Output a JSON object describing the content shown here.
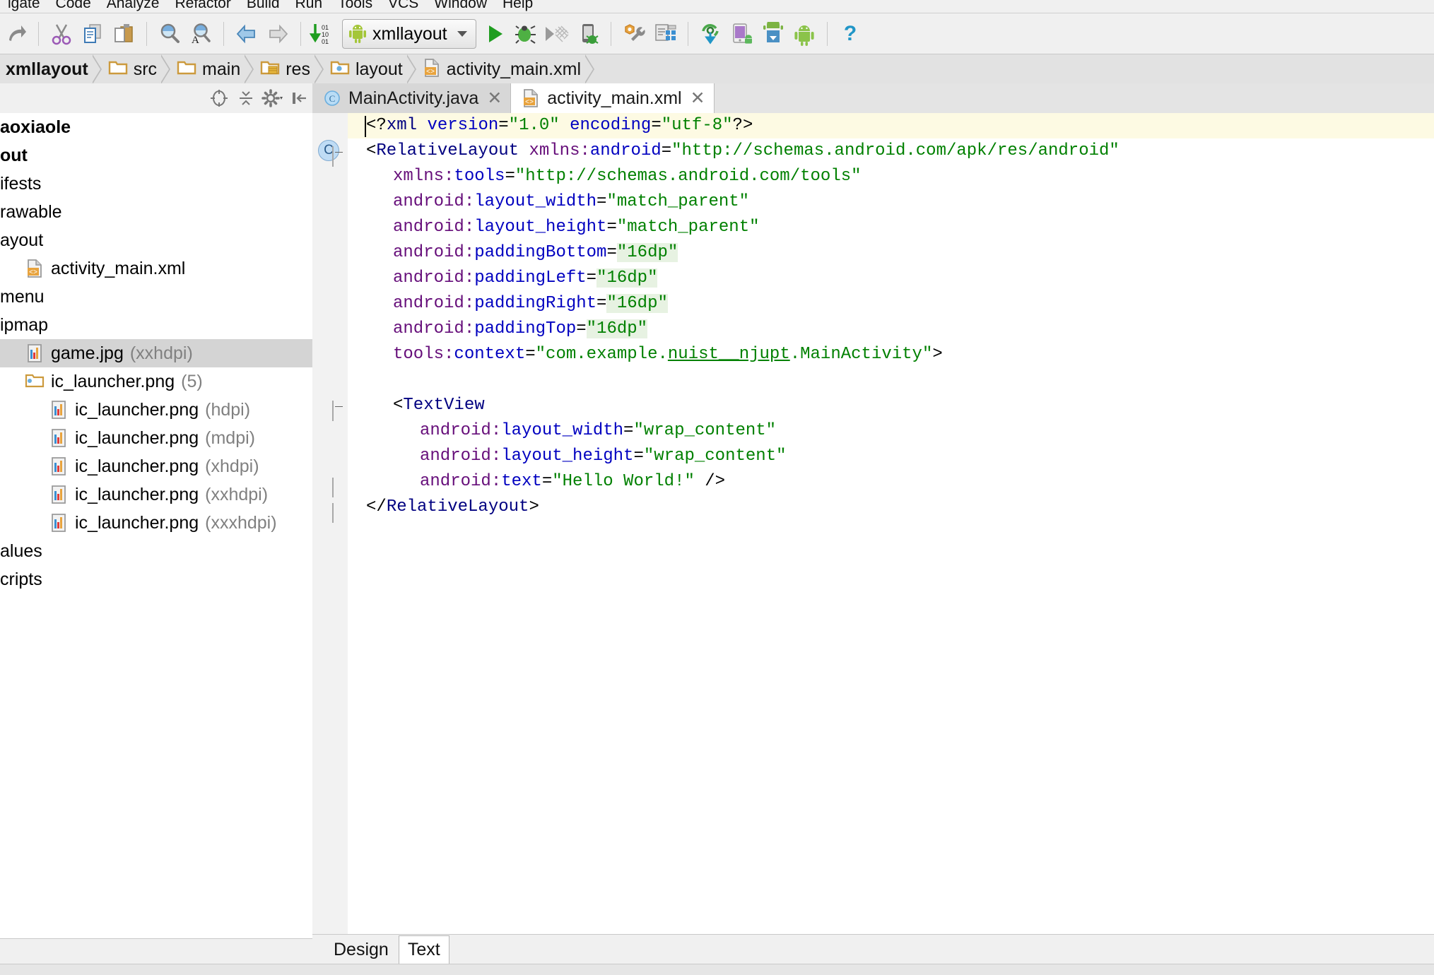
{
  "menu": {
    "items": [
      "igate",
      "Code",
      "Analyze",
      "Refactor",
      "Build",
      "Run",
      "Tools",
      "VCS",
      "Window",
      "Help"
    ]
  },
  "toolbar": {
    "run_config_label": "xmllayout",
    "icons": [
      "redo-icon",
      "cut-icon",
      "copy-icon",
      "paste-icon",
      "find-icon",
      "replace-icon",
      "back-icon",
      "forward-icon",
      "update-project-icon",
      "run-icon",
      "debug-icon",
      "coverage-icon",
      "android-device-debug-icon",
      "sdk-manager-icon",
      "avd-manager-icon",
      "gradle-sync-icon",
      "android-device-monitor-icon",
      "sdk-download-icon",
      "android-icon",
      "help-icon"
    ]
  },
  "breadcrumb": {
    "items": [
      {
        "label": "xmllayout",
        "icon": "module-icon"
      },
      {
        "label": "src",
        "icon": "folder-icon"
      },
      {
        "label": "main",
        "icon": "folder-icon"
      },
      {
        "label": "res",
        "icon": "res-folder-icon"
      },
      {
        "label": "layout",
        "icon": "layout-folder-icon"
      },
      {
        "label": "activity_main.xml",
        "icon": "xml-file-icon"
      }
    ]
  },
  "project_panel": {
    "toolbar_icons": [
      "collapse-caret-icon",
      "locate-target-icon",
      "collapse-all-icon",
      "settings-gear-icon",
      "hide-panel-icon"
    ],
    "tree": [
      {
        "label": "aoxiaole",
        "bold": true,
        "qualifier": "",
        "indent": 0,
        "icon": "",
        "selected": false
      },
      {
        "label": "out",
        "bold": true,
        "qualifier": "",
        "indent": 0,
        "icon": "",
        "selected": false
      },
      {
        "label": "ifests",
        "bold": false,
        "qualifier": "",
        "indent": 0,
        "icon": "",
        "selected": false
      },
      {
        "label": "rawable",
        "bold": false,
        "qualifier": "",
        "indent": 0,
        "icon": "",
        "selected": false
      },
      {
        "label": "ayout",
        "bold": false,
        "qualifier": "",
        "indent": 0,
        "icon": "",
        "selected": false
      },
      {
        "label": "activity_main.xml",
        "bold": false,
        "qualifier": "",
        "indent": 1,
        "icon": "xml-file-icon",
        "selected": false
      },
      {
        "label": "menu",
        "bold": false,
        "qualifier": "",
        "indent": 0,
        "icon": "",
        "selected": false
      },
      {
        "label": "ipmap",
        "bold": false,
        "qualifier": "",
        "indent": 0,
        "icon": "",
        "selected": false
      },
      {
        "label": "game.jpg",
        "bold": false,
        "qualifier": "(xxhdpi)",
        "indent": 1,
        "icon": "image-file-icon",
        "selected": true
      },
      {
        "label": "ic_launcher.png",
        "bold": false,
        "qualifier": "(5)",
        "indent": 1,
        "icon": "image-group-icon",
        "selected": false
      },
      {
        "label": "ic_launcher.png",
        "bold": false,
        "qualifier": "(hdpi)",
        "indent": 2,
        "icon": "image-file-icon",
        "selected": false
      },
      {
        "label": "ic_launcher.png",
        "bold": false,
        "qualifier": "(mdpi)",
        "indent": 2,
        "icon": "image-file-icon",
        "selected": false
      },
      {
        "label": "ic_launcher.png",
        "bold": false,
        "qualifier": "(xhdpi)",
        "indent": 2,
        "icon": "image-file-icon",
        "selected": false
      },
      {
        "label": "ic_launcher.png",
        "bold": false,
        "qualifier": "(xxhdpi)",
        "indent": 2,
        "icon": "image-file-icon",
        "selected": false
      },
      {
        "label": "ic_launcher.png",
        "bold": false,
        "qualifier": "(xxxhdpi)",
        "indent": 2,
        "icon": "image-file-icon",
        "selected": false
      },
      {
        "label": "alues",
        "bold": false,
        "qualifier": "",
        "indent": 0,
        "icon": "",
        "selected": false
      },
      {
        "label": "cripts",
        "bold": false,
        "qualifier": "",
        "indent": 0,
        "icon": "",
        "selected": false
      }
    ]
  },
  "editor_tabs": [
    {
      "label": "MainActivity.java",
      "icon": "java-class-icon",
      "active": false,
      "close": "✕"
    },
    {
      "label": "activity_main.xml",
      "icon": "xml-file-icon",
      "active": true,
      "close": "✕"
    }
  ],
  "editor": {
    "gutter_marker": "C",
    "lines": [
      {
        "indent": 0,
        "highlight": true,
        "caret": true,
        "tokens": [
          {
            "t": "<?",
            "c": "s-punct"
          },
          {
            "t": "xml",
            "c": "s-tag"
          },
          {
            "t": " ",
            "c": "s-punct"
          },
          {
            "t": "version",
            "c": "s-attr"
          },
          {
            "t": "=",
            "c": "s-punct"
          },
          {
            "t": "\"1.0\"",
            "c": "s-val"
          },
          {
            "t": " ",
            "c": "s-punct"
          },
          {
            "t": "encoding",
            "c": "s-attr"
          },
          {
            "t": "=",
            "c": "s-punct"
          },
          {
            "t": "\"utf-8\"",
            "c": "s-val"
          },
          {
            "t": "?>",
            "c": "s-punct"
          }
        ]
      },
      {
        "indent": 0,
        "fold": "start",
        "marker": "C",
        "tokens": [
          {
            "t": "<",
            "c": "s-punct"
          },
          {
            "t": "RelativeLayout",
            "c": "s-tag"
          },
          {
            "t": " ",
            "c": "s-punct"
          },
          {
            "t": "xmlns:",
            "c": "s-ns"
          },
          {
            "t": "android",
            "c": "s-attr"
          },
          {
            "t": "=",
            "c": "s-punct"
          },
          {
            "t": "\"http://schemas.android.com/apk/res/android\"",
            "c": "s-val"
          }
        ]
      },
      {
        "indent": 1,
        "tokens": [
          {
            "t": "xmlns:",
            "c": "s-ns"
          },
          {
            "t": "tools",
            "c": "s-attr"
          },
          {
            "t": "=",
            "c": "s-punct"
          },
          {
            "t": "\"http://schemas.android.com/tools\"",
            "c": "s-val"
          }
        ]
      },
      {
        "indent": 1,
        "tokens": [
          {
            "t": "android:",
            "c": "s-ns"
          },
          {
            "t": "layout_width",
            "c": "s-attr"
          },
          {
            "t": "=",
            "c": "s-punct"
          },
          {
            "t": "\"match_parent\"",
            "c": "s-val"
          }
        ]
      },
      {
        "indent": 1,
        "tokens": [
          {
            "t": "android:",
            "c": "s-ns"
          },
          {
            "t": "layout_height",
            "c": "s-attr"
          },
          {
            "t": "=",
            "c": "s-punct"
          },
          {
            "t": "\"match_parent\"",
            "c": "s-val"
          }
        ]
      },
      {
        "indent": 1,
        "tokens": [
          {
            "t": "android:",
            "c": "s-ns"
          },
          {
            "t": "paddingBottom",
            "c": "s-attr"
          },
          {
            "t": "=",
            "c": "s-punct"
          },
          {
            "t": "\"16dp\"",
            "c": "s-dim"
          }
        ]
      },
      {
        "indent": 1,
        "tokens": [
          {
            "t": "android:",
            "c": "s-ns"
          },
          {
            "t": "paddingLeft",
            "c": "s-attr"
          },
          {
            "t": "=",
            "c": "s-punct"
          },
          {
            "t": "\"16dp\"",
            "c": "s-dim"
          }
        ]
      },
      {
        "indent": 1,
        "tokens": [
          {
            "t": "android:",
            "c": "s-ns"
          },
          {
            "t": "paddingRight",
            "c": "s-attr"
          },
          {
            "t": "=",
            "c": "s-punct"
          },
          {
            "t": "\"16dp\"",
            "c": "s-dim"
          }
        ]
      },
      {
        "indent": 1,
        "tokens": [
          {
            "t": "android:",
            "c": "s-ns"
          },
          {
            "t": "paddingTop",
            "c": "s-attr"
          },
          {
            "t": "=",
            "c": "s-punct"
          },
          {
            "t": "\"16dp\"",
            "c": "s-dim"
          }
        ]
      },
      {
        "indent": 1,
        "tokens": [
          {
            "t": "tools:",
            "c": "s-ns"
          },
          {
            "t": "context",
            "c": "s-attr"
          },
          {
            "t": "=",
            "c": "s-punct"
          },
          {
            "t": "\"com.example.",
            "c": "s-val"
          },
          {
            "t": "nuist__njupt",
            "c": "s-pkg-u"
          },
          {
            "t": ".MainActivity\"",
            "c": "s-val"
          },
          {
            "t": ">",
            "c": "s-punct"
          }
        ]
      },
      {
        "indent": 0,
        "tokens": []
      },
      {
        "indent": 1,
        "fold": "start",
        "tokens": [
          {
            "t": "<",
            "c": "s-punct"
          },
          {
            "t": "TextView",
            "c": "s-tag"
          }
        ]
      },
      {
        "indent": 2,
        "tokens": [
          {
            "t": "android:",
            "c": "s-ns"
          },
          {
            "t": "layout_width",
            "c": "s-attr"
          },
          {
            "t": "=",
            "c": "s-punct"
          },
          {
            "t": "\"wrap_content\"",
            "c": "s-val"
          }
        ]
      },
      {
        "indent": 2,
        "tokens": [
          {
            "t": "android:",
            "c": "s-ns"
          },
          {
            "t": "layout_height",
            "c": "s-attr"
          },
          {
            "t": "=",
            "c": "s-punct"
          },
          {
            "t": "\"wrap_content\"",
            "c": "s-val"
          }
        ]
      },
      {
        "indent": 2,
        "fold": "end",
        "tokens": [
          {
            "t": "android:",
            "c": "s-ns"
          },
          {
            "t": "text",
            "c": "s-attr"
          },
          {
            "t": "=",
            "c": "s-punct"
          },
          {
            "t": "\"Hello World!\"",
            "c": "s-val"
          },
          {
            "t": " />",
            "c": "s-punct"
          }
        ]
      },
      {
        "indent": 0,
        "fold": "end",
        "tokens": [
          {
            "t": "</",
            "c": "s-punct"
          },
          {
            "t": "RelativeLayout",
            "c": "s-tag"
          },
          {
            "t": ">",
            "c": "s-punct"
          }
        ]
      }
    ]
  },
  "design_text_tabs": [
    {
      "label": "Design",
      "active": false
    },
    {
      "label": "Text",
      "active": true
    }
  ],
  "colors": {
    "tag": "#000080",
    "namespace": "#660e7a",
    "attribute": "#0000c0",
    "value": "#008000",
    "dimension_highlight": "#e7f2e2",
    "caret_line": "#fdfae3",
    "selection": "#d4d4d4",
    "android_green": "#a4c639",
    "run_green": "#1f9d20"
  }
}
